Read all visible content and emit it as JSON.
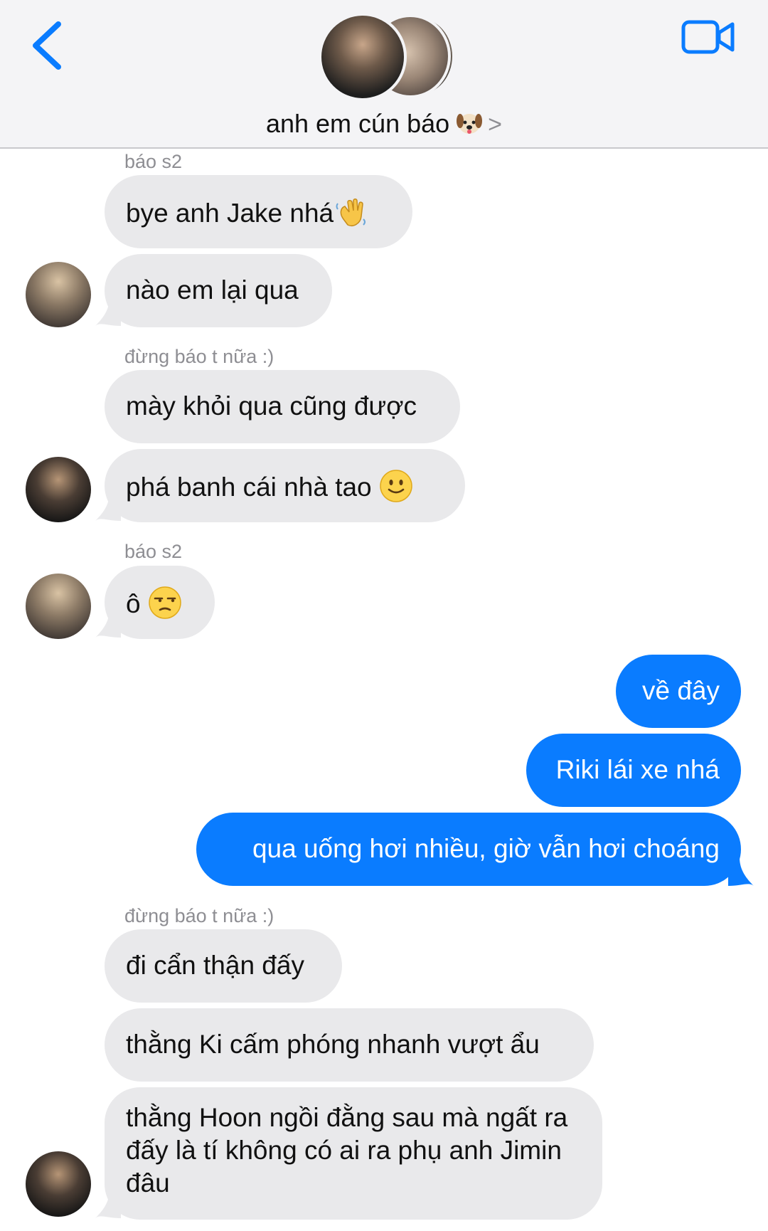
{
  "header": {
    "title": "anh em cún báo",
    "chevron": ">",
    "back_icon": "chevron-left-icon",
    "video_icon": "video-camera-icon",
    "accent": "#0a7cff"
  },
  "messages": [
    {
      "sender": "báo s2",
      "bubbles": [
        "bye anh Jake nhá",
        "nào em lại qua"
      ]
    },
    {
      "sender": "đừng báo t nữa :)",
      "bubbles": [
        "mày khỏi qua cũng được",
        "phá banh cái nhà tao"
      ]
    },
    {
      "sender": "báo s2",
      "bubbles": [
        "ô"
      ]
    },
    {
      "sender": "",
      "outgoing": [
        "về đây",
        "Riki lái xe nhá",
        "qua uống hơi nhiều, giờ vẫn hơi choáng"
      ]
    },
    {
      "sender": "đừng báo t nữa :)",
      "bubbles": [
        "đi cẩn thận đấy",
        "thằng Ki cấm phóng nhanh vượt ẩu",
        "thằng Hoon ngồi đằng sau mà ngất ra đấy là tí không có ai ra phụ anh Jimin đâu"
      ]
    }
  ],
  "colors": {
    "incoming_bubble": "#e9e9eb",
    "outgoing_bubble": "#0a7cff",
    "sender_label": "#8e8e93"
  }
}
